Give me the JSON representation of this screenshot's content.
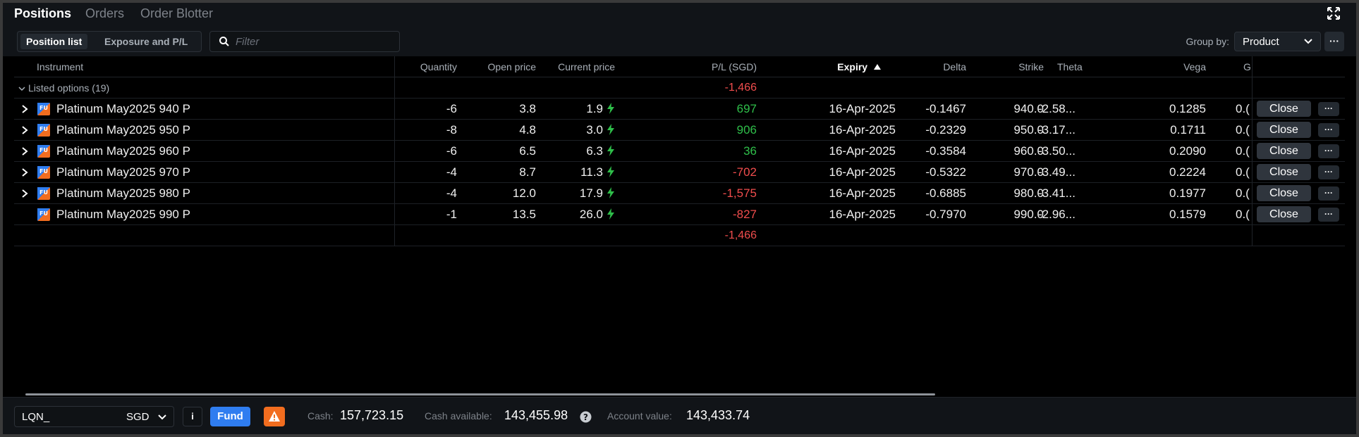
{
  "tabs": [
    {
      "label": "Positions",
      "active": true
    },
    {
      "label": "Orders",
      "active": false
    },
    {
      "label": "Order Blotter",
      "active": false
    }
  ],
  "toolbar": {
    "view_buttons": [
      {
        "label": "Position list",
        "active": true
      },
      {
        "label": "Exposure and P/L",
        "active": false
      }
    ],
    "filter_placeholder": "Filter",
    "group_by_label": "Group by:",
    "group_by_value": "Product",
    "more_label": "···"
  },
  "columns": [
    "Instrument",
    "Quantity",
    "Open price",
    "Current price",
    "P/L (SGD)",
    "Expiry",
    "Delta",
    "Strike",
    "Theta",
    "Vega",
    "G"
  ],
  "group": {
    "label": "Listed options (19)",
    "pl": "-1,466"
  },
  "rows": [
    {
      "instrument": "Platinum May2025 940 P",
      "quantity": "-6",
      "open_price": "3.8",
      "current_price": "1.9",
      "pl": "697",
      "pl_sign": "pos",
      "expiry": "16-Apr-2025",
      "delta": "-0.1467",
      "strike": "940.0",
      "theta": "-2.58...",
      "vega": "0.1285",
      "g": "0.(",
      "expandable": true
    },
    {
      "instrument": "Platinum May2025 950 P",
      "quantity": "-8",
      "open_price": "4.8",
      "current_price": "3.0",
      "pl": "906",
      "pl_sign": "pos",
      "expiry": "16-Apr-2025",
      "delta": "-0.2329",
      "strike": "950.0",
      "theta": "-3.17...",
      "vega": "0.1711",
      "g": "0.(",
      "expandable": true
    },
    {
      "instrument": "Platinum May2025 960 P",
      "quantity": "-6",
      "open_price": "6.5",
      "current_price": "6.3",
      "pl": "36",
      "pl_sign": "pos",
      "expiry": "16-Apr-2025",
      "delta": "-0.3584",
      "strike": "960.0",
      "theta": "-3.50...",
      "vega": "0.2090",
      "g": "0.(",
      "expandable": true
    },
    {
      "instrument": "Platinum May2025 970 P",
      "quantity": "-4",
      "open_price": "8.7",
      "current_price": "11.3",
      "pl": "-702",
      "pl_sign": "neg",
      "expiry": "16-Apr-2025",
      "delta": "-0.5322",
      "strike": "970.0",
      "theta": "-3.49...",
      "vega": "0.2224",
      "g": "0.(",
      "expandable": true
    },
    {
      "instrument": "Platinum May2025 980 P",
      "quantity": "-4",
      "open_price": "12.0",
      "current_price": "17.9",
      "pl": "-1,575",
      "pl_sign": "neg",
      "expiry": "16-Apr-2025",
      "delta": "-0.6885",
      "strike": "980.0",
      "theta": "-3.41...",
      "vega": "0.1977",
      "g": "0.(",
      "expandable": true
    },
    {
      "instrument": "Platinum May2025 990 P",
      "quantity": "-1",
      "open_price": "13.5",
      "current_price": "26.0",
      "pl": "-827",
      "pl_sign": "neg",
      "expiry": "16-Apr-2025",
      "delta": "-0.7970",
      "strike": "990.0",
      "theta": "-2.96...",
      "vega": "0.1579",
      "g": "0.(",
      "expandable": false
    }
  ],
  "row_actions": {
    "close_label": "Close",
    "more_label": "···"
  },
  "total_pl": "-1,466",
  "product_badge": "FU",
  "footer": {
    "account_id": "LQN_",
    "currency": "SGD",
    "info_label": "i",
    "fund_label": "Fund",
    "cash_label": "Cash:",
    "cash_value": "157,723.15",
    "cash_available_label": "Cash available:",
    "cash_available_value": "143,455.98",
    "account_value_label": "Account value:",
    "account_value_value": "143,433.74"
  },
  "colors": {
    "positive": "#2fbf4a",
    "negative": "#f04d4d",
    "accent": "#2f7df0",
    "warning": "#f26d1f"
  }
}
